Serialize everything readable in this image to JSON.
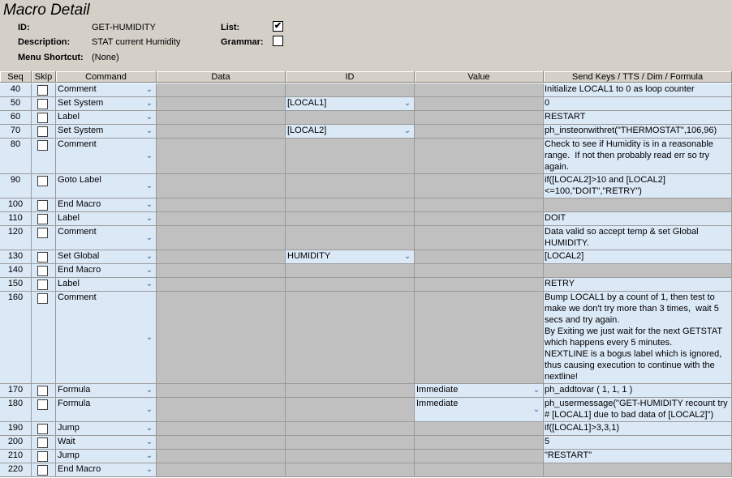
{
  "window": {
    "title": "Macro Detail"
  },
  "fields": {
    "id_label": "ID:",
    "id_value": "GET-HUMIDITY",
    "description_label": "Description:",
    "description_value": "STAT current Humidity",
    "shortcut_label": "Menu Shortcut:",
    "shortcut_value": "(None)",
    "list_label": "List:",
    "list_checked": true,
    "list_mark": "✔",
    "grammar_label": "Grammar:",
    "grammar_checked": false
  },
  "columns": [
    "Seq",
    "Skip",
    "Command",
    "Data",
    "ID",
    "Value",
    "Send Keys / TTS / Dim / Formula"
  ],
  "rows": [
    {
      "seq": "40",
      "command": "Comment",
      "id": "",
      "value": "",
      "formula": "Initialize LOCAL1 to 0 as loop counter"
    },
    {
      "seq": "50",
      "command": "Set System",
      "id": "[LOCAL1]",
      "value": "",
      "formula": "0"
    },
    {
      "seq": "60",
      "command": "Label",
      "id": "",
      "value": "",
      "formula": "RESTART"
    },
    {
      "seq": "70",
      "command": "Set System",
      "id": "[LOCAL2]",
      "value": "",
      "formula": "ph_insteonwithret(\"THERMOSTAT\",106,96)"
    },
    {
      "seq": "80",
      "command": "Comment",
      "id": "",
      "value": "",
      "formula": "Check to see if Humidity is in a reasonable range.  If not then probably read err so try again."
    },
    {
      "seq": "90",
      "command": "Goto Label",
      "id": "",
      "value": "",
      "formula": "if([LOCAL2]>10 and [LOCAL2]<=100,\"DOIT\",\"RETRY\")"
    },
    {
      "seq": "100",
      "command": "End Macro",
      "id": "",
      "value": "",
      "formula": ""
    },
    {
      "seq": "110",
      "command": "Label",
      "id": "",
      "value": "",
      "formula": "DOIT"
    },
    {
      "seq": "120",
      "command": "Comment",
      "id": "",
      "value": "",
      "formula": "Data valid so accept temp & set Global HUMIDITY."
    },
    {
      "seq": "130",
      "command": "Set Global",
      "id": "HUMIDITY",
      "value": "",
      "formula": "[LOCAL2]"
    },
    {
      "seq": "140",
      "command": "End Macro",
      "id": "",
      "value": "",
      "formula": ""
    },
    {
      "seq": "150",
      "command": "Label",
      "id": "",
      "value": "",
      "formula": "RETRY"
    },
    {
      "seq": "160",
      "command": "Comment",
      "id": "",
      "value": "",
      "formula": "Bump LOCAL1 by a count of 1, then test to make we don't try more than 3 times,  wait 5 secs and try again.\nBy Exiting we just wait for the next GETSTAT which happens every 5 minutes.\nNEXTLINE is a bogus label which is ignored, thus causing execution to continue with the nextline!"
    },
    {
      "seq": "170",
      "command": "Formula",
      "id": "",
      "value": "Immediate",
      "formula": "ph_addtovar ( 1, 1, 1 )"
    },
    {
      "seq": "180",
      "command": "Formula",
      "id": "",
      "value": "Immediate",
      "formula": "ph_usermessage(\"GET-HUMIDITY recount try # [LOCAL1] due to bad data of [LOCAL2]\")"
    },
    {
      "seq": "190",
      "command": "Jump",
      "id": "",
      "value": "",
      "formula": "if([LOCAL1]>3,3,1)"
    },
    {
      "seq": "200",
      "command": "Wait",
      "id": "",
      "value": "",
      "formula": "5"
    },
    {
      "seq": "210",
      "command": "Jump",
      "id": "",
      "value": "",
      "formula": "\"RESTART\""
    },
    {
      "seq": "220",
      "command": "End Macro",
      "id": "",
      "value": "",
      "formula": ""
    }
  ],
  "colors": {
    "header_bg": "#d4d0c8",
    "cell_blue": "#dbe8f6",
    "cell_gray": "#c0c0c0"
  }
}
